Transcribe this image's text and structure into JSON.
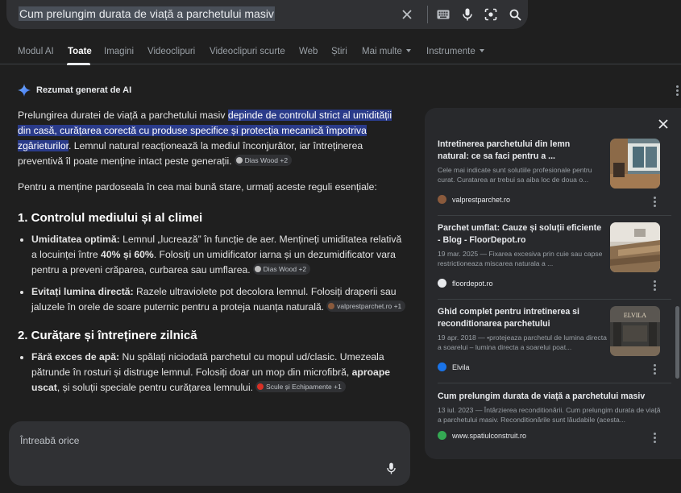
{
  "search": {
    "query": "Cum prelungim durata de viață a parchetului masiv",
    "icons": [
      "close-icon",
      "keyboard-icon",
      "mic-icon",
      "lens-icon",
      "search-icon"
    ]
  },
  "tabs": [
    {
      "label": "Modul AI"
    },
    {
      "label": "Toate",
      "active": true
    },
    {
      "label": "Imagini"
    },
    {
      "label": "Videoclipuri"
    },
    {
      "label": "Videoclipuri scurte"
    },
    {
      "label": "Web"
    },
    {
      "label": "Știri"
    },
    {
      "label": "Mai multe"
    },
    {
      "label": "Instrumente"
    }
  ],
  "ai": {
    "header": "Rezumat generat de AI",
    "intro_plain": "Prelungirea duratei de viață a parchetului masiv ",
    "intro_highlight": "depinde de controlul strict al umidității din casă, curățarea corectă cu produse specifice și protecția mecanică împotriva zgârieturilor",
    "intro_rest": ". Lemnul natural reacționează la mediul înconjurător, iar întreținerea preventivă îl poate menține intact peste generații.",
    "intro_source": "Dias Wood +2",
    "lead": "Pentru a menține pardoseala în cea mai bună stare, urmați aceste reguli esențiale:",
    "section1": {
      "title": "1. Controlul mediului și al climei",
      "b1_label": "Umiditatea optimă:",
      "b1_text1": " Lemnul „lucrează” în funcție de aer. Mențineți umiditatea relativă a locuinței între ",
      "b1_bold": "40% și 60%",
      "b1_text2": ". Folosiți un umidificator iarna și un dezumidificator vara pentru a preveni crăparea, curbarea sau umflarea.",
      "b1_source": "Dias Wood +2",
      "b2_label": "Evitați lumina directă:",
      "b2_text": " Razele ultraviolete pot decolora lemnul. Folosiți draperii sau jaluzele în orele de soare puternic pentru a proteja nuanța naturală.",
      "b2_source": "valprestparchet.ro +1"
    },
    "section2": {
      "title": "2. Curățare și întreținere zilnică",
      "b1_label": "Fără exces de apă:",
      "b1_text1": " Nu spălați niciodată parchetul cu mopul ud/clasic. Umezeala pătrunde în rosturi și distruge lemnul. Folosiți doar un mop din microfibră, ",
      "b1_bold": "aproape uscat",
      "b1_text2": ", și soluții speciale pentru curățarea lemnului.",
      "b1_source": "Scule și Echipamente +1"
    }
  },
  "ask": {
    "placeholder": "Întreabă orice"
  },
  "sources": [
    {
      "title": "Intretinerea parchetului din lemn natural: ce sa faci pentru a ...",
      "desc": "Cele mai indicate sunt solutiile profesionale pentru curat. Curatarea ar trebui sa aiba loc de doua o...",
      "site": "valprestparchet.ro",
      "fav_color": "#8a5a3c"
    },
    {
      "title": "Parchet umflat: Cauze și soluții eficiente - Blog - FloorDepot.ro",
      "desc": "19 mar. 2025 — Fixarea excesiva prin cuie sau capse restrictioneaza miscarea naturala a ...",
      "site": "floordepot.ro",
      "fav_color": "#e8eaed"
    },
    {
      "title": "Ghid complet pentru intretinerea si reconditionarea parchetului",
      "desc": "19 apr. 2018 — •protejeaza parchetul de lumina directa a soarelui – lumina directa a soarelui poat...",
      "site": "Elvila",
      "fav_color": "#1a73e8",
      "thumb_text": "ELVILA"
    },
    {
      "title": "Cum prelungim durata de viață a parchetului masiv",
      "desc": "13 iul. 2023 — Întârzierea reconditionării. Cum prelungim durata de viață a parchetului masiv. Reconditionările sunt lăudabile (acesta...",
      "site": "www.spatiulconstruit.ro",
      "fav_color": "#34a853"
    }
  ]
}
